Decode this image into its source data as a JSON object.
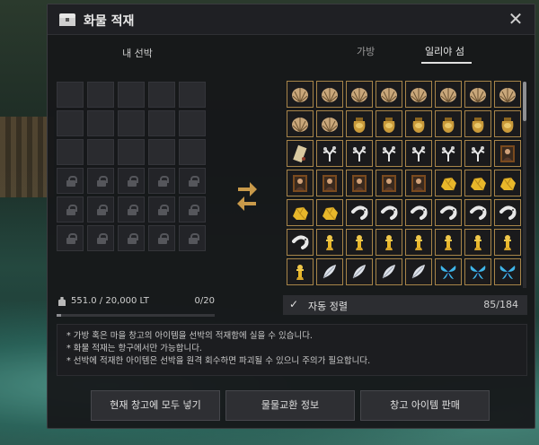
{
  "window": {
    "title": "화물 적재",
    "icon": "chest-icon",
    "close": "✕"
  },
  "left": {
    "header": "내 선박",
    "open_slots": 15,
    "locked_slots": 15,
    "weight_text": "551.0 / 20,000 LT",
    "slot_count": "0/20",
    "weight_fraction": 0.028
  },
  "right": {
    "tabs": [
      "가방",
      "일리야 섬"
    ],
    "active_tab": 1,
    "items": [
      "shell",
      "shell",
      "shell",
      "shell",
      "shell",
      "shell",
      "shell",
      "shell",
      "shell",
      "shell",
      "sack",
      "sack",
      "sack",
      "sack",
      "sack",
      "sack",
      "scroll",
      "coral",
      "coral",
      "coral",
      "coral",
      "coral",
      "coral",
      "portrait",
      "portrait",
      "portrait",
      "portrait",
      "portrait",
      "portrait",
      "gold",
      "gold",
      "gold",
      "gold",
      "gold",
      "shrimp",
      "shrimp",
      "shrimp",
      "shrimp",
      "shrimp",
      "shrimp",
      "shrimp",
      "statue",
      "statue",
      "statue",
      "statue",
      "statue",
      "statue",
      "statue",
      "statue",
      "feather",
      "feather",
      "feather",
      "feather",
      "butterfly",
      "butterfly",
      "butterfly"
    ],
    "sort_checked": "✓",
    "sort_label": "자동 정렬",
    "capacity": "85/184"
  },
  "notice": [
    "* 가방 혹은 마을 창고의 아이템을 선박의 적재함에 실을 수 있습니다.",
    "* 화물 적재는 항구에서만 가능합니다.",
    "* 선박에 적재한 아이템은 선박을 원격 회수하면 파괴될 수 있으니 주의가 필요합니다."
  ],
  "buttons": {
    "load_all": "현재 창고에 모두 넣기",
    "barter_info": "물물교환 정보",
    "sell_items": "창고 아이템 판매"
  }
}
